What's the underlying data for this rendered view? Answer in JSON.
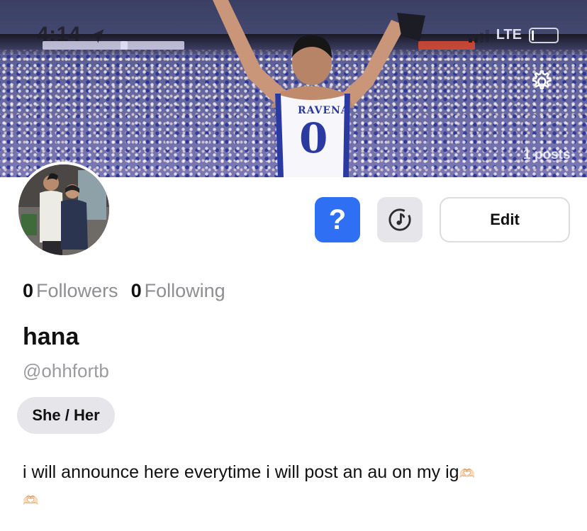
{
  "status_bar": {
    "time": "4:14",
    "network": "LTE"
  },
  "cover": {
    "jersey_name": "RAVENA",
    "jersey_number": "0",
    "posts_label": "1 posts"
  },
  "profile": {
    "followers_count": "0",
    "followers_label": "Followers",
    "following_count": "0",
    "following_label": "Following",
    "display_name": "hana",
    "username": "@ohhfortb",
    "pronouns": "She / Her",
    "bio": "i will announce here everytime i will post an au on my ig",
    "bio_emoji": "🫶🏻"
  },
  "buttons": {
    "help_label": "?",
    "edit_label": "Edit"
  },
  "icons": {
    "settings": "gear-icon",
    "music": "music-note-icon",
    "location": "location-arrow-icon"
  },
  "colors": {
    "accent_blue": "#2f6ff3",
    "muted_gray": "#8e8e93",
    "chip_bg": "#e6e6ea"
  }
}
